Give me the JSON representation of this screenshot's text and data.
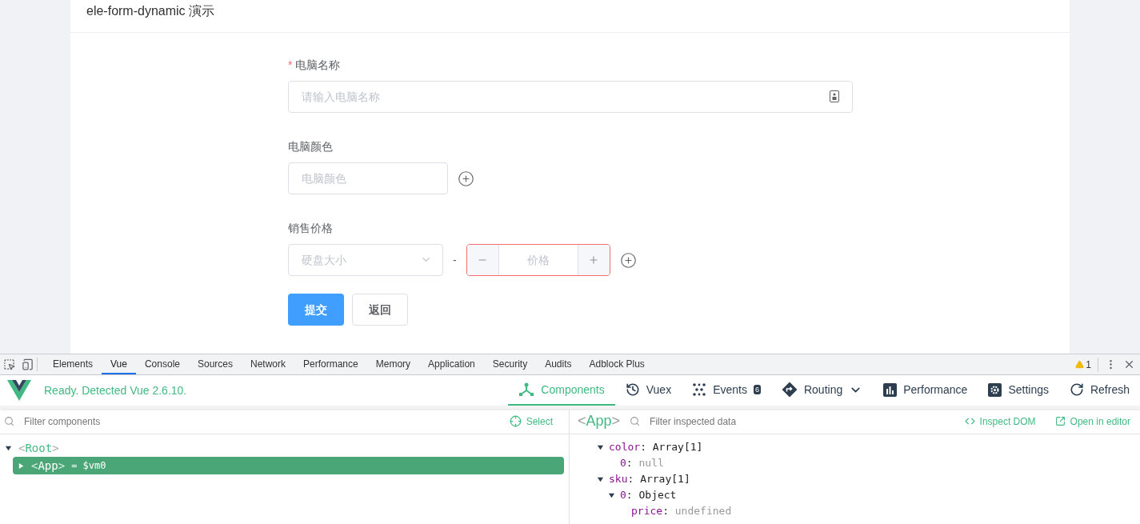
{
  "page": {
    "title": "ele-form-dynamic 演示"
  },
  "form": {
    "fields": [
      {
        "kind": "text",
        "label": "电脑名称",
        "required": true,
        "required_mark": "*",
        "placeholder": "请输入电脑名称"
      },
      {
        "kind": "array",
        "label": "电脑颜色",
        "required": false,
        "placeholder": "电脑颜色"
      },
      {
        "kind": "range",
        "label": "销售价格",
        "required": false,
        "select_placeholder": "硬盘大小",
        "separator": "-",
        "number_placeholder": "价格",
        "error": true
      }
    ],
    "buttons": [
      {
        "kind": "primary",
        "label": "提交"
      },
      {
        "kind": "default",
        "label": "返回"
      }
    ]
  },
  "devtools": {
    "tabs": [
      {
        "label": "Elements",
        "selected": false
      },
      {
        "label": "Vue",
        "selected": true
      },
      {
        "label": "Console",
        "selected": false
      },
      {
        "label": "Sources",
        "selected": false
      },
      {
        "label": "Network",
        "selected": false
      },
      {
        "label": "Performance",
        "selected": false
      },
      {
        "label": "Memory",
        "selected": false
      },
      {
        "label": "Application",
        "selected": false
      },
      {
        "label": "Security",
        "selected": false
      },
      {
        "label": "Audits",
        "selected": false
      },
      {
        "label": "Adblock Plus",
        "selected": false
      }
    ],
    "warning_count": "1",
    "vue": {
      "status": "Ready. Detected Vue 2.6.10.",
      "nav": [
        {
          "kind": "components",
          "label": "Components",
          "selected": true
        },
        {
          "kind": "vuex",
          "label": "Vuex",
          "selected": false
        },
        {
          "kind": "events",
          "label": "Events",
          "selected": false,
          "badge": "6"
        },
        {
          "kind": "routing",
          "label": "Routing",
          "selected": false
        },
        {
          "kind": "performance",
          "label": "Performance",
          "selected": false
        },
        {
          "kind": "settings",
          "label": "Settings",
          "selected": false
        },
        {
          "kind": "refresh",
          "label": "Refresh",
          "selected": false
        }
      ],
      "brackets": [
        "<",
        ">"
      ],
      "components": {
        "filter_placeholder": "Filter components",
        "select_label": "Select",
        "tree": [
          {
            "name": "Root",
            "expanded": true,
            "selected": false,
            "children": [
              {
                "name": "App",
                "expanded": false,
                "selected": true,
                "ref": "= $vm0"
              }
            ]
          }
        ]
      },
      "inspector": {
        "component": "App",
        "filter_placeholder": "Filter inspected data",
        "inspect_label": "Inspect DOM",
        "editor_label": "Open in editor",
        "separator": ":",
        "rows": [
          {
            "key": "color",
            "value": "Array[1]",
            "empty": false,
            "expanded": true,
            "children": [
              {
                "key": "0",
                "value": "null",
                "empty": true
              }
            ]
          },
          {
            "key": "sku",
            "value": "Array[1]",
            "empty": false,
            "expanded": true,
            "children": [
              {
                "key": "0",
                "value": "Object",
                "empty": false,
                "expanded": true,
                "children": [
                  {
                    "key": "price",
                    "value": "undefined",
                    "empty": true
                  }
                ]
              }
            ]
          }
        ]
      }
    }
  }
}
